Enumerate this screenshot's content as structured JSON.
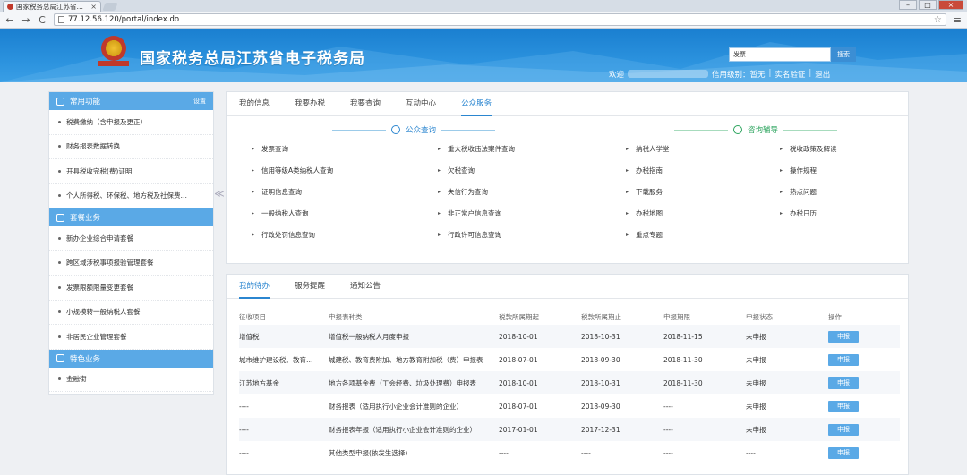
{
  "browser": {
    "tab_title": "国家税务总局江苏省…",
    "tab_close": "×",
    "url": "77.12.56.120/portal/index.do",
    "back": "←",
    "forward": "→",
    "reload": "C",
    "star": "☆",
    "menu": "≡",
    "win_min": "–",
    "win_max": "□",
    "win_close": "×"
  },
  "header": {
    "title": "国家税务总局江苏省电子税务局",
    "search_value": "发票",
    "search_button": "搜索",
    "welcome": "欢迎",
    "credit": "信用级别：暂无",
    "realname": "实名验证",
    "logout": "退出",
    "sep": "|"
  },
  "sidebar": {
    "sections": [
      {
        "title": "常用功能",
        "action": "设置",
        "items": [
          "税费缴纳（含申报及更正）",
          "财务报表数据转换",
          "开具税收完税(费)证明",
          "个人所得税、环保税、地方税及社保费…"
        ]
      },
      {
        "title": "套餐业务",
        "items": [
          "新办企业综合申请套餐",
          "跨区域涉税事项报验管理套餐",
          "发票限额限量变更套餐",
          "小规模转一般纳税人套餐",
          "非居民企业管理套餐"
        ]
      },
      {
        "title": "特色业务",
        "items": [
          "金融街"
        ]
      }
    ],
    "collapse": "≪"
  },
  "main": {
    "tabs": [
      "我的信息",
      "我要办税",
      "我要查询",
      "互动中心",
      "公众服务"
    ],
    "active_tab": 4,
    "public_query": {
      "title": "公众查询",
      "col1": [
        "发票查询",
        "信用等级A类纳税人查询",
        "证明信息查询",
        "一般纳税人查询",
        "行政处罚信息查询"
      ],
      "col2": [
        "重大税收违法案件查询",
        "欠税查询",
        "失信行为查询",
        "非正常户信息查询",
        "行政许可信息查询"
      ]
    },
    "consult": {
      "title": "咨询辅导",
      "col1": [
        "纳税人学堂",
        "办税指南",
        "下载服务",
        "办税地图",
        "重点专题"
      ],
      "col2": [
        "税收政策及解读",
        "操作规程",
        "热点问题",
        "办税日历"
      ]
    },
    "arrow": "▸"
  },
  "todo": {
    "tabs": [
      "我的待办",
      "服务提醒",
      "通知公告"
    ],
    "active_tab": 0,
    "headers": [
      "征收项目",
      "申报表种类",
      "税款所属期起",
      "税款所属期止",
      "申报期限",
      "申报状态",
      "操作"
    ],
    "rows": [
      [
        "增值税",
        "增值税一般纳税人月度申报",
        "2018-10-01",
        "2018-10-31",
        "2018-11-15",
        "未申报",
        "申报"
      ],
      [
        "城市维护建设税、教育…",
        "城建税、教育费附加、地方教育附加税（费）申报表",
        "2018-07-01",
        "2018-09-30",
        "2018-11-30",
        "未申报",
        "申报"
      ],
      [
        "江苏地方基金",
        "地方各项基金费（工会经费、垃圾处理费）申报表",
        "2018-10-01",
        "2018-10-31",
        "2018-11-30",
        "未申报",
        "申报"
      ],
      [
        "----",
        "财务报表（适用执行小企业会计准则的企业）",
        "2018-07-01",
        "2018-09-30",
        "----",
        "未申报",
        "申报"
      ],
      [
        "----",
        "财务报表年报（适用执行小企业会计准则的企业）",
        "2017-01-01",
        "2017-12-31",
        "----",
        "未申报",
        "申报"
      ],
      [
        "----",
        "其他类型申报(依发生选择)",
        "----",
        "----",
        "----",
        "----",
        "申报"
      ]
    ]
  }
}
